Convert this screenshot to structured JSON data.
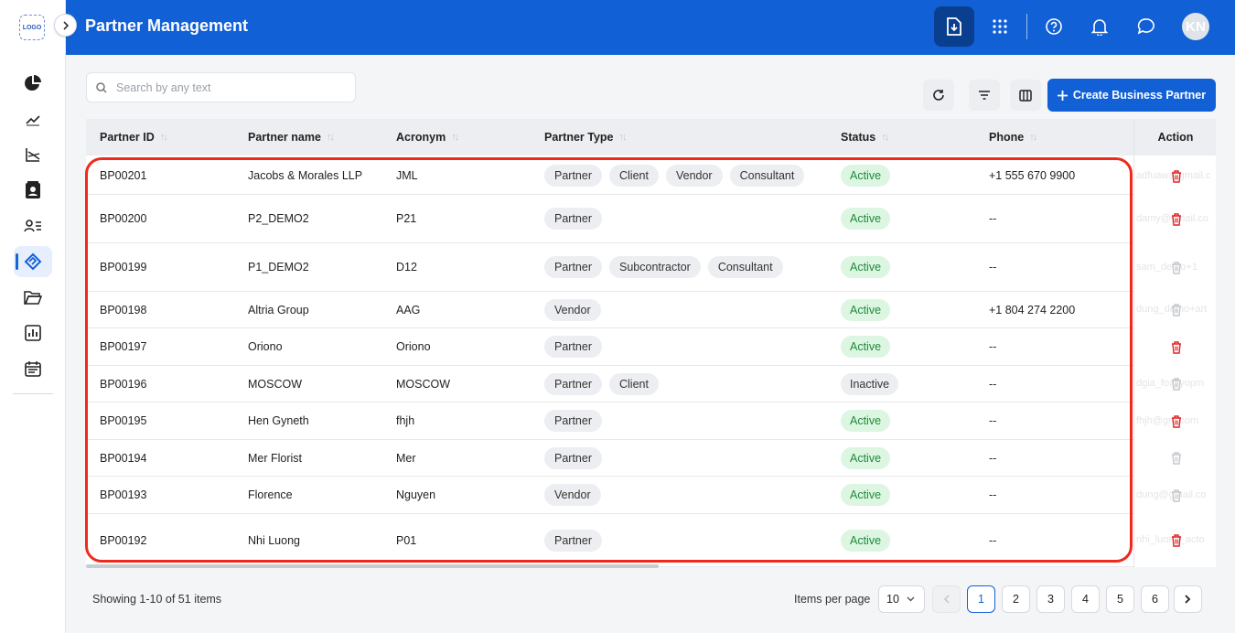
{
  "app": {
    "logo_text": "LOGO",
    "title": "Partner Management",
    "user_initials": "KN"
  },
  "search": {
    "placeholder": "Search by any text",
    "value": ""
  },
  "toolbar": {
    "create_label": "Create Business Partner"
  },
  "table": {
    "columns": [
      "Partner ID",
      "Partner name",
      "Acronym",
      "Partner Type",
      "Status",
      "Phone"
    ],
    "action_label": "Action",
    "rows": [
      {
        "id": "BP00201",
        "name": "Jacobs & Morales LLP",
        "acronym": "JML",
        "types": [
          "Partner",
          "Client",
          "Vendor",
          "Consultant"
        ],
        "status": "Active",
        "phone": "+1 555 670 9900",
        "email": "adfuaw@gmail.c"
      },
      {
        "id": "BP00200",
        "name": "P2_DEMO2",
        "acronym": "P21",
        "types": [
          "Partner"
        ],
        "status": "Active",
        "phone": "--",
        "email": "damy@gmail.co"
      },
      {
        "id": "BP00199",
        "name": "P1_DEMO2",
        "acronym": "D12",
        "types": [
          "Partner",
          "Subcontractor",
          "Consultant"
        ],
        "status": "Active",
        "phone": "--",
        "email": "sam_demo+1"
      },
      {
        "id": "BP00198",
        "name": "Altria Group",
        "acronym": "AAG",
        "types": [
          "Vendor"
        ],
        "status": "Active",
        "phone": "+1 804 274 2200",
        "email": "dung_demo+art"
      },
      {
        "id": "BP00197",
        "name": "Oriono",
        "acronym": "Oriono",
        "types": [
          "Partner"
        ],
        "status": "Active",
        "phone": "--",
        "email": ""
      },
      {
        "id": "BP00196",
        "name": "MOSCOW",
        "acronym": "MOSCOW",
        "types": [
          "Partner",
          "Client"
        ],
        "status": "Inactive",
        "phone": "--",
        "email": "dgia_fo@yopm"
      },
      {
        "id": "BP00195",
        "name": "Hen Gyneth",
        "acronym": "fhjh",
        "types": [
          "Partner"
        ],
        "status": "Active",
        "phone": "--",
        "email": "fhjh@gm.com"
      },
      {
        "id": "BP00194",
        "name": "Mer Florist",
        "acronym": "Mer",
        "types": [
          "Partner"
        ],
        "status": "Active",
        "phone": "--",
        "email": ""
      },
      {
        "id": "BP00193",
        "name": "Florence",
        "acronym": "Nguyen",
        "types": [
          "Vendor"
        ],
        "status": "Active",
        "phone": "--",
        "email": "dung@gmail.co"
      },
      {
        "id": "BP00192",
        "name": "Nhi Luong",
        "acronym": "P01",
        "types": [
          "Partner"
        ],
        "status": "Active",
        "phone": "--",
        "email": "nhi_luong_acto"
      }
    ]
  },
  "footer": {
    "showing": "Showing 1-10 of 51 items",
    "items_per_page_label": "Items per page",
    "items_per_page": "10",
    "pages": [
      "1",
      "2",
      "3",
      "4",
      "5",
      "6"
    ],
    "current_page": "1"
  },
  "colors": {
    "brand": "#1160d6",
    "active_bg": "#dcf6e2",
    "active_text": "#1e8a3a",
    "delete": "#e02424",
    "highlight": "#ee2a1c"
  }
}
